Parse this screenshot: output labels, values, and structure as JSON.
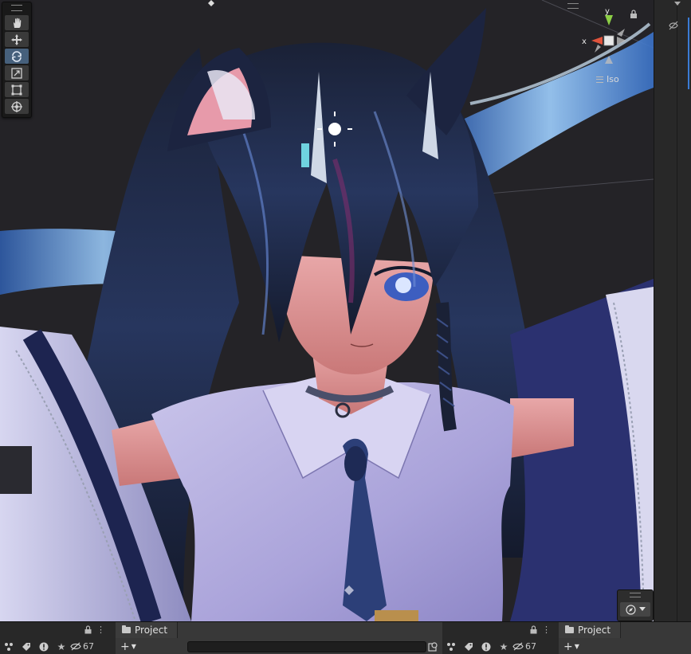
{
  "tools": {
    "items": [
      {
        "id": "hand",
        "icon": "hand-icon",
        "active": false
      },
      {
        "id": "move",
        "icon": "move-icon",
        "active": false
      },
      {
        "id": "rotate",
        "icon": "rotate-icon",
        "active": true
      },
      {
        "id": "scale",
        "icon": "scale-icon",
        "active": false
      },
      {
        "id": "rect",
        "icon": "rect-transform-icon",
        "active": false
      },
      {
        "id": "transform",
        "icon": "transform-icon",
        "active": false
      }
    ]
  },
  "gizmo": {
    "axis_x": "x",
    "axis_y": "y",
    "projection": "Iso",
    "colors": {
      "x": "#e0533c",
      "y": "#8ccf46",
      "z": "#5a8bd6"
    }
  },
  "overlay": {
    "icon": "compass-icon",
    "dropdown": "chevron-down-icon"
  },
  "left_panel": {
    "visible_count": "67",
    "icons": [
      "hierarchy-icon",
      "label-icon",
      "info-icon",
      "star-icon",
      "eye-hidden-icon"
    ]
  },
  "project_panel": {
    "tab_label": "Project",
    "search_placeholder": "",
    "add_label": "+"
  },
  "right_panel": {
    "visible_count": "67",
    "tab_label": "Project",
    "add_label": "+"
  },
  "colors": {
    "viewport_bg": "#242327",
    "panel_bg": "#282828",
    "accent": "#46607c"
  }
}
